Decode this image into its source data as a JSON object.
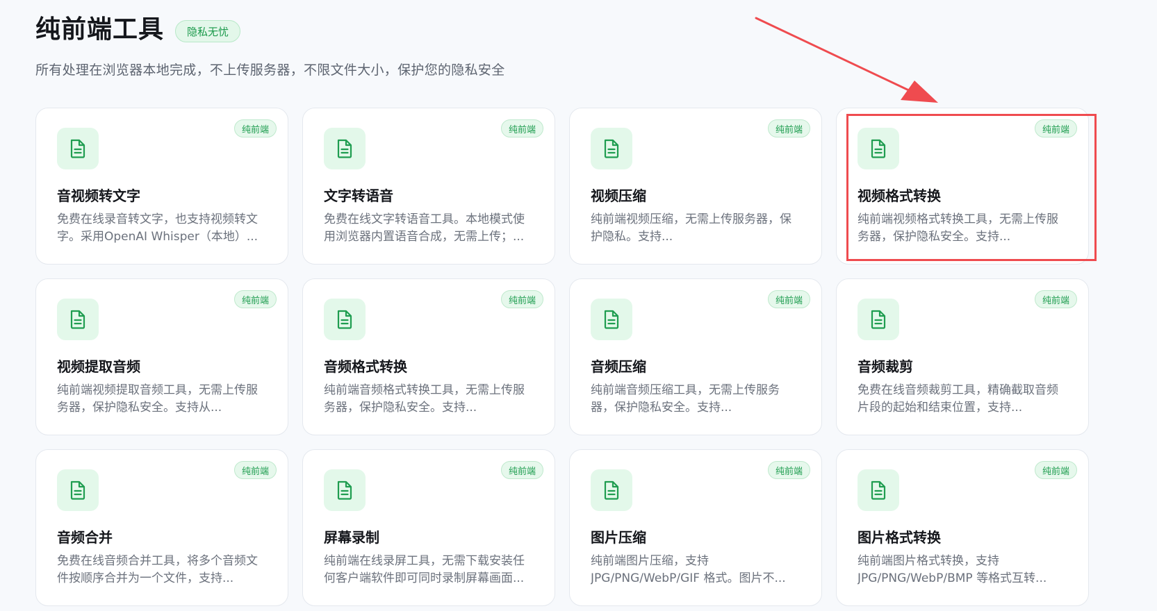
{
  "header": {
    "title": "纯前端工具",
    "badge": "隐私无忧",
    "subtitle": "所有处理在浏览器本地完成，不上传服务器，不限文件大小，保护您的隐私安全"
  },
  "colors": {
    "accent": "#1f9d50",
    "highlight": "#ef4b4f"
  },
  "tools": [
    {
      "tag": "纯前端",
      "icon": "document-icon",
      "title": "音视频转文字",
      "desc": "免费在线录音转文字，也支持视频转文字。采用OpenAI Whisper（本地）..."
    },
    {
      "tag": "纯前端",
      "icon": "document-icon",
      "title": "文字转语音",
      "desc": "免费在线文字转语音工具。本地模式使用浏览器内置语音合成，无需上传；..."
    },
    {
      "tag": "纯前端",
      "icon": "document-icon",
      "title": "视频压缩",
      "desc": "纯前端视频压缩，无需上传服务器，保护隐私。支持..."
    },
    {
      "tag": "纯前端",
      "icon": "document-icon",
      "title": "视频格式转换",
      "desc": "纯前端视频格式转换工具，无需上传服务器，保护隐私安全。支持..."
    },
    {
      "tag": "纯前端",
      "icon": "document-icon",
      "title": "视频提取音频",
      "desc": "纯前端视频提取音频工具，无需上传服务器，保护隐私安全。支持从..."
    },
    {
      "tag": "纯前端",
      "icon": "document-icon",
      "title": "音频格式转换",
      "desc": "纯前端音频格式转换工具，无需上传服务器，保护隐私安全。支持..."
    },
    {
      "tag": "纯前端",
      "icon": "document-icon",
      "title": "音频压缩",
      "desc": "纯前端音频压缩工具，无需上传服务器，保护隐私安全。支持..."
    },
    {
      "tag": "纯前端",
      "icon": "document-icon",
      "title": "音频裁剪",
      "desc": "免费在线音频裁剪工具，精确截取音频片段的起始和结束位置，支持..."
    },
    {
      "tag": "纯前端",
      "icon": "document-icon",
      "title": "音频合并",
      "desc": "免费在线音频合并工具，将多个音频文件按顺序合并为一个文件，支持..."
    },
    {
      "tag": "纯前端",
      "icon": "document-icon",
      "title": "屏幕录制",
      "desc": "纯前端在线录屏工具，无需下载安装任何客户端软件即可同时录制屏幕画面..."
    },
    {
      "tag": "纯前端",
      "icon": "document-icon",
      "title": "图片压缩",
      "desc": "纯前端图片压缩，支持JPG/PNG/WebP/GIF 格式。图片不..."
    },
    {
      "tag": "纯前端",
      "icon": "document-icon",
      "title": "图片格式转换",
      "desc": "纯前端图片格式转换，支持JPG/PNG/WebP/BMP 等格式互转..."
    }
  ]
}
